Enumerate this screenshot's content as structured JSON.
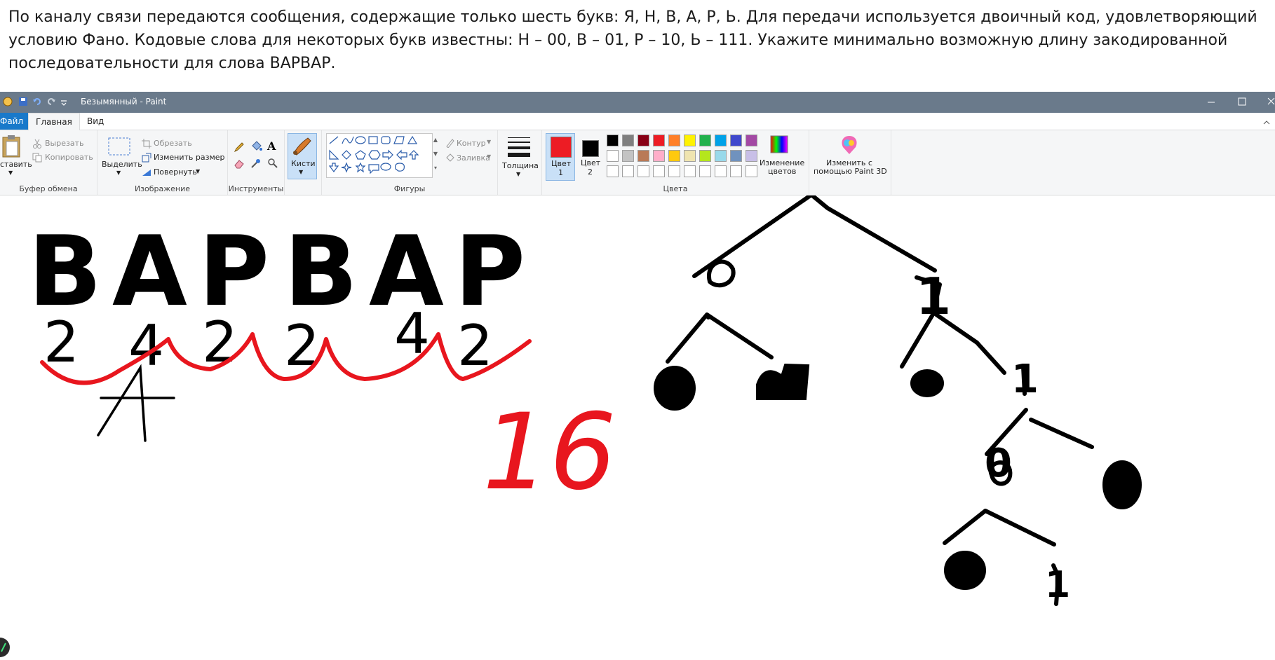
{
  "problem": {
    "text": "По каналу связи передаются сообщения, содержащие только шесть букв: Я, Н, В, А, Р, Ь. Для передачи используется двоичный код, удовлетворяющий условию Фано. Кодовые слова для некоторых букв известны: Н – 00, В – 01, Р – 10, Ь – 111. Укажите минимально возможную длину закодированной последовательности для слова ВАРВАР."
  },
  "window": {
    "title": "Безымянный - Paint",
    "tabs": {
      "file": "Файл",
      "home": "Главная",
      "view": "Вид"
    }
  },
  "ribbon": {
    "clipboard": {
      "paste": "ставить",
      "cut": "Вырезать",
      "copy": "Копировать",
      "group": "Буфер обмена"
    },
    "image": {
      "select": "Выделить",
      "crop": "Обрезать",
      "resize": "Изменить размер",
      "rotate": "Повернуть",
      "group": "Изображение"
    },
    "tools": {
      "group": "Инструменты"
    },
    "brushes": {
      "label": "Кисти"
    },
    "shapes": {
      "outline": "Контур",
      "fill": "Заливка",
      "group": "Фигуры"
    },
    "size": {
      "label": "Толщина"
    },
    "colors": {
      "color1_line1": "Цвет",
      "color1_line2": "1",
      "color2_line1": "Цвет",
      "color2_line2": "2",
      "edit_line1": "Изменение",
      "edit_line2": "цветов",
      "group": "Цвета",
      "color1": "#ed1c24",
      "color2": "#000000",
      "row1": [
        "#000000",
        "#7f7f7f",
        "#880015",
        "#ed1c24",
        "#ff7f27",
        "#fff200",
        "#22b14c",
        "#00a2e8",
        "#3f48cc",
        "#a349a4"
      ],
      "row2": [
        "#ffffff",
        "#c3c3c3",
        "#b97a57",
        "#ffaec9",
        "#ffc90e",
        "#efe4b0",
        "#b5e61d",
        "#99d9ea",
        "#7092be",
        "#c8bfe7"
      ]
    },
    "paint3d": {
      "line1": "Изменить с",
      "line2": "помощью Paint 3D"
    }
  },
  "canvas": {
    "word_letters": [
      "В",
      "А",
      "Р",
      "В",
      "А",
      "Р"
    ],
    "code_lengths": [
      "2",
      "4",
      "2",
      "2",
      "4",
      "2"
    ],
    "answer": "16",
    "crossed_letter": "А",
    "tree_labels": [
      "0",
      "1",
      "1",
      "0",
      "1"
    ]
  }
}
